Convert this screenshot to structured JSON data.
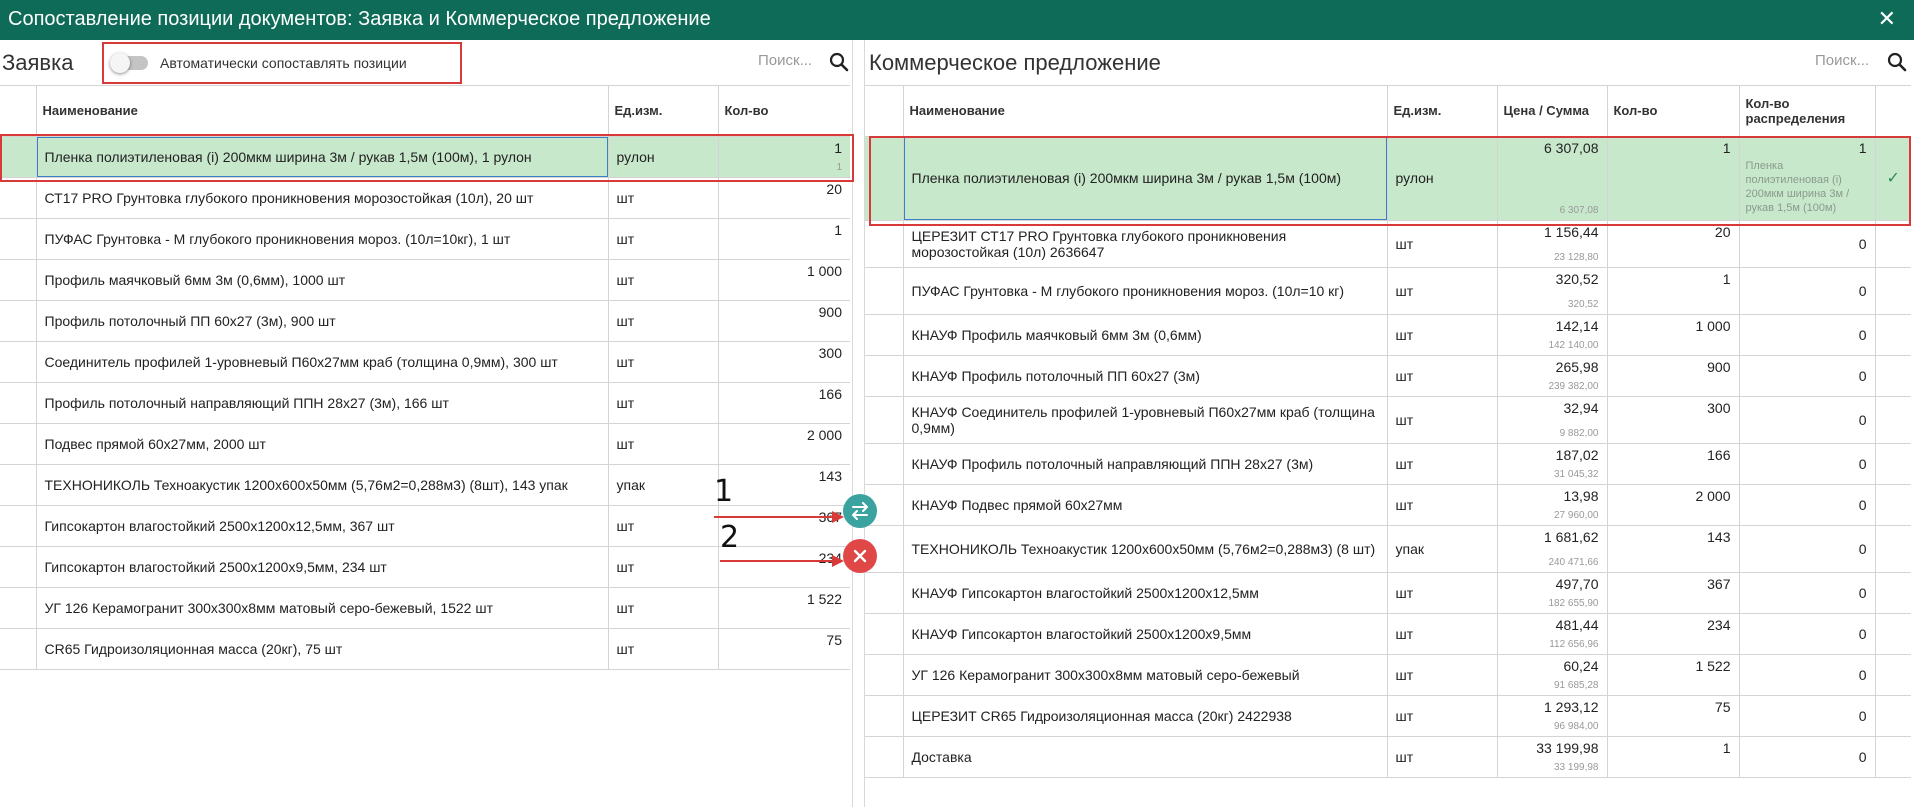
{
  "window": {
    "title": "Сопоставление позиции документов: Заявка и Коммерческое предложение",
    "close_icon": "close-icon"
  },
  "left": {
    "title": "Заявка",
    "toggle_label": "Автоматически сопоставлять позиции",
    "search_placeholder": "Поиск...",
    "columns": [
      "Наименование",
      "Ед.изм.",
      "Кол-во"
    ],
    "rows": [
      {
        "name": "Пленка полиэтиленовая (i) 200мкм ширина 3м / рукав 1,5м (100м), 1 рулон",
        "unit": "рулон",
        "qty": "1",
        "qty2": "1",
        "selected": true
      },
      {
        "name": "СТ17 PRO Грунтовка глубокого проникновения морозостойкая (10л), 20 шт",
        "unit": "шт",
        "qty": "20"
      },
      {
        "name": "ПУФАС Грунтовка - М глубокого проникновения мороз. (10л=10кг), 1 шт",
        "unit": "шт",
        "qty": "1"
      },
      {
        "name": "Профиль маячковый 6мм 3м (0,6мм), 1000 шт",
        "unit": "шт",
        "qty": "1 000"
      },
      {
        "name": "Профиль потолочный ПП 60х27 (3м), 900 шт",
        "unit": "шт",
        "qty": "900"
      },
      {
        "name": "Соединитель профилей 1-уровневый П60х27мм краб (толщина 0,9мм), 300 шт",
        "unit": "шт",
        "qty": "300"
      },
      {
        "name": "Профиль потолочный направляющий ППН 28х27 (3м), 166 шт",
        "unit": "шт",
        "qty": "166"
      },
      {
        "name": "Подвес прямой 60х27мм, 2000 шт",
        "unit": "шт",
        "qty": "2 000"
      },
      {
        "name": "ТЕХНОНИКОЛЬ Техноакустик 1200х600х50мм (5,76м2=0,288м3) (8шт), 143 упак",
        "unit": "упак",
        "qty": "143"
      },
      {
        "name": "Гипсокартон влагостойкий 2500х1200х12,5мм, 367 шт",
        "unit": "шт",
        "qty": "367"
      },
      {
        "name": "Гипсокартон влагостойкий 2500х1200х9,5мм, 234 шт",
        "unit": "шт",
        "qty": "234"
      },
      {
        "name": "УГ 126 Керамогранит 300х300х8мм матовый серо-бежевый, 1522 шт",
        "unit": "шт",
        "qty": "1 522"
      },
      {
        "name": "CR65 Гидроизоляционная масса (20кг), 75 шт",
        "unit": "шт",
        "qty": "75"
      }
    ]
  },
  "right": {
    "title": "Коммерческое предложение",
    "search_placeholder": "Поиск...",
    "columns": [
      "Наименование",
      "Ед.изм.",
      "Цена / Сумма",
      "Кол-во",
      "Кол-во распределения"
    ],
    "rows": [
      {
        "name": "Пленка полиэтиленовая (i) 200мкм ширина 3м / рукав 1,5м (100м)",
        "unit": "рулон",
        "price": "6 307,08",
        "sum": "6 307,08",
        "qty": "1",
        "dist": "1",
        "dist_text": "Пленка полиэтиленовая (i) 200мкм ширина 3м / рукав 1,5м (100м)",
        "selected": true
      },
      {
        "name": "ЦЕРЕЗИТ СТ17 PRO Грунтовка глубокого проникновения морозостойкая (10л) 2636647",
        "unit": "шт",
        "price": "1 156,44",
        "sum": "23 128,80",
        "qty": "20",
        "dist": "0",
        "tall": true
      },
      {
        "name": "ПУФАС Грунтовка - М глубокого проникновения мороз. (10л=10 кг)",
        "unit": "шт",
        "price": "320,52",
        "sum": "320,52",
        "qty": "1",
        "dist": "0",
        "tall": true
      },
      {
        "name": "КНАУФ Профиль маячковый 6мм 3м (0,6мм)",
        "unit": "шт",
        "price": "142,14",
        "sum": "142 140,00",
        "qty": "1 000",
        "dist": "0"
      },
      {
        "name": "КНАУФ Профиль потолочный ПП 60х27 (3м)",
        "unit": "шт",
        "price": "265,98",
        "sum": "239 382,00",
        "qty": "900",
        "dist": "0"
      },
      {
        "name": "КНАУФ Соединитель профилей 1-уровневый П60х27мм краб (толщина 0,9мм)",
        "unit": "шт",
        "price": "32,94",
        "sum": "9 882,00",
        "qty": "300",
        "dist": "0",
        "tall": true
      },
      {
        "name": "КНАУФ Профиль потолочный направляющий ППН 28х27 (3м)",
        "unit": "шт",
        "price": "187,02",
        "sum": "31 045,32",
        "qty": "166",
        "dist": "0"
      },
      {
        "name": "КНАУФ Подвес прямой 60х27мм",
        "unit": "шт",
        "price": "13,98",
        "sum": "27 960,00",
        "qty": "2 000",
        "dist": "0"
      },
      {
        "name": "ТЕХНОНИКОЛЬ Техноакустик 1200х600х50мм (5,76м2=0,288м3) (8 шт)",
        "unit": "упак",
        "price": "1 681,62",
        "sum": "240 471,66",
        "qty": "143",
        "dist": "0",
        "tall": true
      },
      {
        "name": "КНАУФ Гипсокартон влагостойкий 2500х1200х12,5мм",
        "unit": "шт",
        "price": "497,70",
        "sum": "182 655,90",
        "qty": "367",
        "dist": "0"
      },
      {
        "name": "КНАУФ Гипсокартон влагостойкий 2500х1200х9,5мм",
        "unit": "шт",
        "price": "481,44",
        "sum": "112 656,96",
        "qty": "234",
        "dist": "0"
      },
      {
        "name": "УГ 126 Керамогранит 300х300х8мм матовый серо-бежевый",
        "unit": "шт",
        "price": "60,24",
        "sum": "91 685,28",
        "qty": "1 522",
        "dist": "0"
      },
      {
        "name": "ЦЕРЕЗИТ CR65 Гидроизоляционная масса (20кг) 2422938",
        "unit": "шт",
        "price": "1 293,12",
        "sum": "96 984,00",
        "qty": "75",
        "dist": "0"
      },
      {
        "name": "Доставка",
        "unit": "шт",
        "price": "33 199,98",
        "sum": "33 199,98",
        "qty": "1",
        "dist": "0"
      }
    ]
  },
  "annotations": {
    "one": "1",
    "two": "2"
  },
  "colors": {
    "titlebar": "#0e6b58",
    "selected_row": "#c8e8cc",
    "highlight": "#d83a3a",
    "swap_button": "#3aa3a0",
    "delete_button": "#e04848"
  }
}
